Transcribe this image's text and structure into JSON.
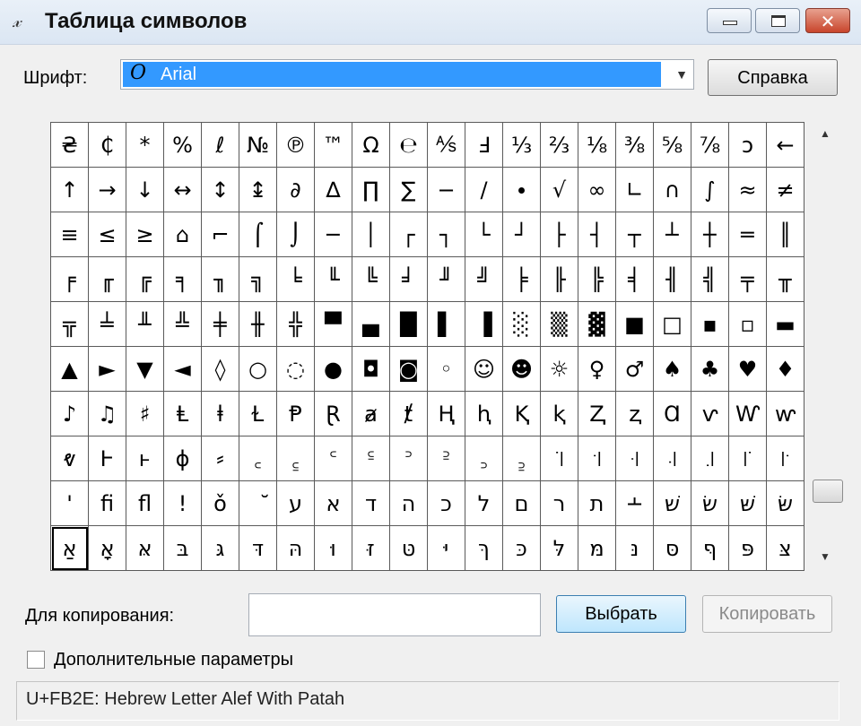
{
  "window": {
    "title": "Таблица символов",
    "icon": "charmap-icon",
    "controls": [
      "minimize",
      "maximize",
      "close"
    ]
  },
  "font": {
    "label": "Шрифт:",
    "value": "Arial",
    "icon_glyph": "O"
  },
  "buttons": {
    "help": "Справка",
    "select": "Выбрать",
    "copy": "Копировать"
  },
  "copy": {
    "label": "Для копирования:",
    "value": ""
  },
  "advanced": {
    "label": "Дополнительные параметры",
    "checked": false
  },
  "status": "U+FB2E: Hebrew Letter Alef With Patah",
  "selected_cell": [
    9,
    0
  ],
  "grid": [
    [
      "₴",
      "₵",
      "*",
      "%",
      "ℓ",
      "№",
      "℗",
      "™",
      "Ω",
      "℮",
      "⅍",
      "Ⅎ",
      "⅓",
      "⅔",
      "⅛",
      "⅜",
      "⅝",
      "⅞",
      "ↄ",
      "←"
    ],
    [
      "↑",
      "→",
      "↓",
      "↔",
      "↕",
      "↨",
      "∂",
      "∆",
      "∏",
      "∑",
      "−",
      "∕",
      "∙",
      "√",
      "∞",
      "∟",
      "∩",
      "∫",
      "≈",
      "≠"
    ],
    [
      "≡",
      "≤",
      "≥",
      "⌂",
      "⌐",
      "⌠",
      "⌡",
      "─",
      "│",
      "┌",
      "┐",
      "└",
      "┘",
      "├",
      "┤",
      "┬",
      "┴",
      "┼",
      "═",
      "║"
    ],
    [
      "╒",
      "╓",
      "╔",
      "╕",
      "╖",
      "╗",
      "╘",
      "╙",
      "╚",
      "╛",
      "╜",
      "╝",
      "╞",
      "╟",
      "╠",
      "╡",
      "╢",
      "╣",
      "╤",
      "╥"
    ],
    [
      "╦",
      "╧",
      "╨",
      "╩",
      "╪",
      "╫",
      "╬",
      "▀",
      "▄",
      "█",
      "▌",
      "▐",
      "░",
      "▒",
      "▓",
      "■",
      "□",
      "▪",
      "▫",
      "▬"
    ],
    [
      "▲",
      "►",
      "▼",
      "◄",
      "◊",
      "○",
      "◌",
      "●",
      "◘",
      "◙",
      "◦",
      "☺",
      "☻",
      "☼",
      "♀",
      "♂",
      "♠",
      "♣",
      "♥",
      "♦"
    ],
    [
      "♪",
      "♫",
      "♯",
      "Ⱡ",
      "ⱡ",
      "Ɫ",
      "Ᵽ",
      "Ɽ",
      "ⱥ",
      "ⱦ",
      "Ⱨ",
      "ⱨ",
      "Ⱪ",
      "ⱪ",
      "Ⱬ",
      "ⱬ",
      "Ɑ",
      "ⱱ",
      "Ⱳ",
      "ⱳ"
    ],
    [
      "ⱴ",
      "Ⱶ",
      "ⱶ",
      "ɸ",
      "⸗",
      "꜀",
      "꜁",
      "꜂",
      "꜃",
      "꜄",
      "꜅",
      "꜆",
      "꜇",
      "꜈",
      "꜉",
      "꜊",
      "꜋",
      "꜌",
      "꜍",
      "꜎"
    ],
    [
      "ꞌ",
      "ﬁ",
      "ﬂ",
      "ǃ",
      "ǒ",
      "ﬞ",
      "ע",
      "א",
      "ד",
      "ה",
      "כ",
      "ל",
      "ם",
      "ר",
      "ת",
      "﬩",
      "שׁ",
      "שׂ",
      "שּׁ",
      "שּׂ"
    ],
    [
      "אַ",
      "אָ",
      "אּ",
      "בּ",
      "גּ",
      "דּ",
      "הּ",
      "וּ",
      "זּ",
      "טּ",
      "יּ",
      "ךּ",
      "כּ",
      "לּ",
      "מּ",
      "נּ",
      "סּ",
      "ףּ",
      "פּ",
      "צּ"
    ]
  ]
}
